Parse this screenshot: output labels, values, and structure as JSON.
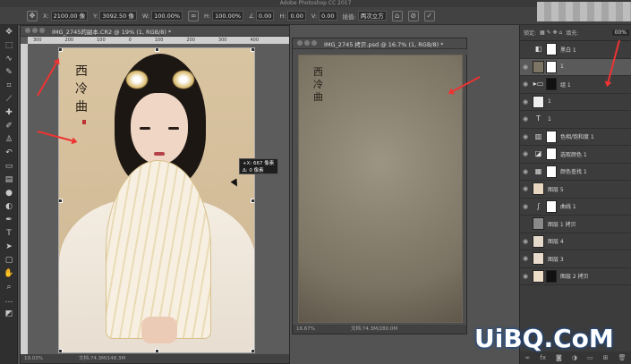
{
  "app": {
    "title": "Adobe Photoshop CC 2017"
  },
  "options": {
    "x_label": "X:",
    "x_value": "2100.00 像",
    "y_label": "Y:",
    "y_value": "3092.50 像",
    "w_label": "W:",
    "w_value": "100.00%",
    "h_label": "H:",
    "h_value": "100.00%",
    "angle_value": "0.00",
    "hskew_label": "H:",
    "hskew_value": "0.00",
    "vskew_label": "V:",
    "vskew_value": "0.00",
    "interp_label": "插值:",
    "interp_value": "两次立方"
  },
  "doc1": {
    "tab_title": "IMG_2745的副本.CR2 @ 19% (1, RGB/8) *",
    "ruler_ticks": [
      "300",
      "200",
      "100",
      "0",
      "100",
      "200",
      "300",
      "400"
    ],
    "calligraphy": "西冷曲",
    "tooltip_dx": "+X: 667 像素",
    "tooltip_dy": "Δ: 0 像素",
    "zoom": "19.03%",
    "filesize": "文档:74.3M/148.3M"
  },
  "doc2": {
    "tab_title": "IMG_2745 拷贝.psd @ 16.7% (1, RGB/8) *",
    "calligraphy": "西冷曲",
    "zoom": "16.67%",
    "filesize": "文档:74.3M/280.0M"
  },
  "layers_panel": {
    "lock_label": "锁定:",
    "fill_label": "填充:",
    "fill_value": "00%",
    "layers": [
      {
        "name": "黑白 1",
        "type": "adjust"
      },
      {
        "name": "1",
        "type": "pixel"
      },
      {
        "name": "组 1",
        "type": "group"
      },
      {
        "name": "1",
        "type": "pixel"
      },
      {
        "name": "1",
        "type": "text"
      },
      {
        "name": "色相/饱和度 1",
        "type": "adjust"
      },
      {
        "name": "选取颜色 1",
        "type": "adjust"
      },
      {
        "name": "颜色查找 1",
        "type": "adjust"
      },
      {
        "name": "图层 5",
        "type": "pixel"
      },
      {
        "name": "曲线 1",
        "type": "adjust"
      },
      {
        "name": "图层 1 拷贝",
        "type": "pixel"
      },
      {
        "name": "图层 4",
        "type": "pixel"
      },
      {
        "name": "图层 3",
        "type": "pixel"
      },
      {
        "name": "图层 2 拷贝",
        "type": "pixel"
      }
    ]
  },
  "watermark": "UiBQ.CoM",
  "colors": {
    "annotation": "#e33333",
    "background": "#535353",
    "panel": "#3c3c3c"
  }
}
